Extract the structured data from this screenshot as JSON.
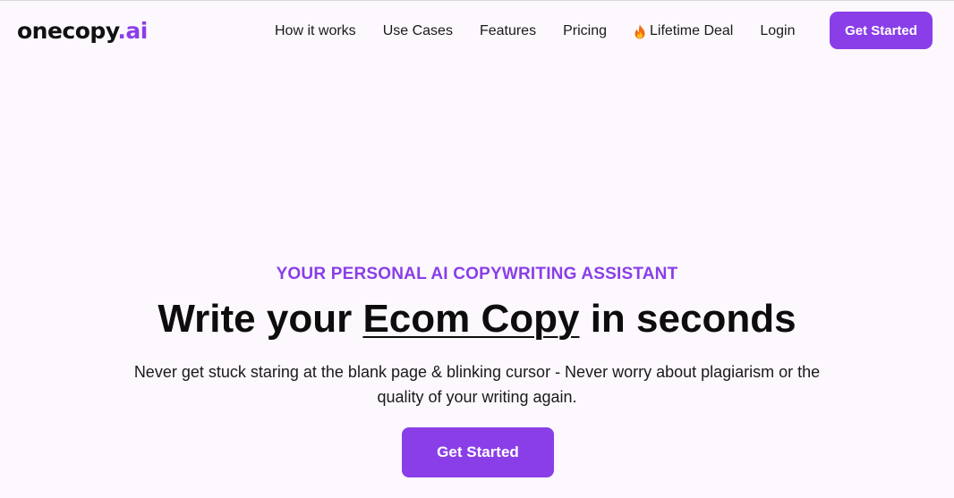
{
  "brand": {
    "name_main": "onecopy",
    "name_accent": ".ai",
    "accent_color": "#8a3ee8"
  },
  "nav": {
    "items": [
      {
        "label": "How it works"
      },
      {
        "label": "Use Cases"
      },
      {
        "label": "Features"
      },
      {
        "label": "Pricing"
      },
      {
        "label": "Lifetime Deal",
        "icon": "fire-icon"
      },
      {
        "label": "Login"
      }
    ],
    "cta_label": "Get Started"
  },
  "hero": {
    "kicker": "YOUR PERSONAL AI COPYWRITING ASSISTANT",
    "title_before": "Write your ",
    "title_highlight": "Ecom Copy",
    "title_after": " in seconds",
    "subtitle": "Never get stuck staring at the blank page & blinking cursor - Never worry about plagiarism or the quality of your writing again.",
    "cta_label": "Get Started"
  }
}
